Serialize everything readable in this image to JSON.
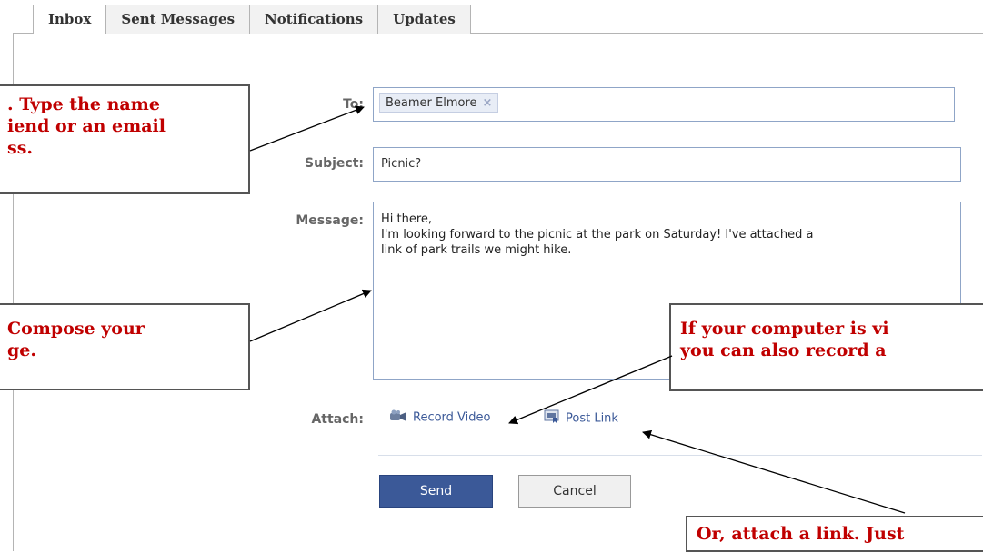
{
  "tabs": [
    {
      "label": "Inbox",
      "active": true
    },
    {
      "label": "Sent Messages",
      "active": false
    },
    {
      "label": "Notifications",
      "active": false
    },
    {
      "label": "Updates",
      "active": false
    }
  ],
  "form": {
    "to_label": "To:",
    "to_token": "Beamer Elmore",
    "subject_label": "Subject:",
    "subject_value": "Picnic?",
    "message_label": "Message:",
    "message_lines": [
      "Hi there,",
      "I'm looking forward to the picnic at the park on Saturday! I've attached a",
      "link of park trails we might hike."
    ],
    "attach_label": "Attach:",
    "record_video_label": "Record Video",
    "post_link_label": "Post Link",
    "send_label": "Send",
    "cancel_label": "Cancel"
  },
  "callouts": {
    "to_lines": [
      ". Type the name",
      "iend or an email",
      "ss."
    ],
    "message_lines": [
      " Compose your",
      "ge."
    ],
    "video_lines": [
      "If your computer is vi",
      "you can also record a"
    ],
    "link_lines": [
      "Or, attach a link. Just"
    ]
  },
  "colors": {
    "accent": "#3b5998",
    "callout_text": "#c00000",
    "input_border": "#8fa5c7"
  },
  "icons": {
    "record_video": "video-camera-icon",
    "post_link": "post-link-icon",
    "remove_token": "close-icon"
  }
}
